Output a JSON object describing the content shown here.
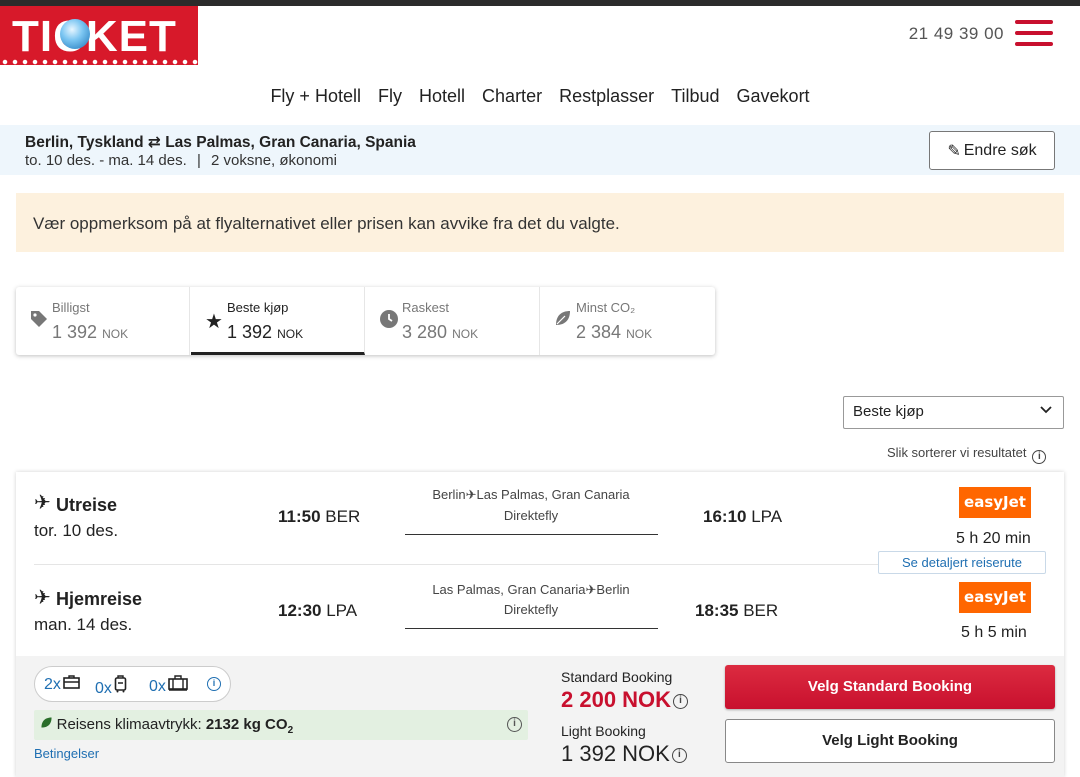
{
  "brand": {
    "logo_text": "TICKET",
    "accent": "#d7192a"
  },
  "header": {
    "phone": "21 49 39 00"
  },
  "nav": {
    "items": [
      "Fly + Hotell",
      "Fly",
      "Hotell",
      "Charter",
      "Restplasser",
      "Tilbud",
      "Gavekort"
    ]
  },
  "search": {
    "from": "Berlin, Tyskland",
    "swap_icon": "⇄",
    "to": "Las Palmas, Gran Canaria, Spania",
    "dates": "to. 10 des. - ma. 14 des.",
    "separator": "|",
    "travellers": "2 voksne, økonomi",
    "edit_label": "Endre søk"
  },
  "notice": {
    "text": "Vær oppmerksom på at flyalternativet eller prisen kan avvike fra det du valgte."
  },
  "tabs": [
    {
      "name": "Billigst",
      "price": "1 392",
      "currency": "NOK",
      "icon": "tag-icon"
    },
    {
      "name": "Beste kjøp",
      "price": "1 392",
      "currency": "NOK",
      "icon": "star-icon"
    },
    {
      "name": "Raskest",
      "price": "3 280",
      "currency": "NOK",
      "icon": "clock-icon"
    },
    {
      "name": "Minst CO₂",
      "price": "2 384",
      "currency": "NOK",
      "icon": "leaf-icon"
    }
  ],
  "sort": {
    "selected": "Beste kjøp",
    "note": "Slik sorterer vi resultatet"
  },
  "legs": {
    "outbound": {
      "label": "Utreise",
      "date": "tor. 10 des.",
      "dep_time": "11:50",
      "dep_code": "BER",
      "from_city": "Berlin",
      "to_city": "Las Palmas, Gran Canaria",
      "stops": "Direktefly",
      "arr_time": "16:10",
      "arr_code": "LPA",
      "airline": "easyJet",
      "duration": "5 h 20 min"
    },
    "return": {
      "label": "Hjemreise",
      "date": "man. 14 des.",
      "dep_time": "12:30",
      "dep_code": "LPA",
      "from_city": "Las Palmas, Gran Canaria",
      "to_city": "Berlin",
      "stops": "Direktefly",
      "arr_time": "18:35",
      "arr_code": "BER",
      "airline": "easyJet",
      "duration": "5 h 5 min"
    },
    "details_link": "Se detaljert reiserute"
  },
  "baggage": {
    "handbag": "2x",
    "cabin": "0x",
    "checked": "0x"
  },
  "climate": {
    "label": "Reisens klimaavtrykk:",
    "value": "2132 kg CO",
    "sub": "2"
  },
  "terms": "Betingelser",
  "booking": {
    "standard_label": "Standard Booking",
    "standard_price": "2 200 NOK",
    "light_label": "Light Booking",
    "light_price": "1 392 NOK",
    "standard_button": "Velg Standard Booking",
    "light_button": "Velg Light Booking"
  }
}
